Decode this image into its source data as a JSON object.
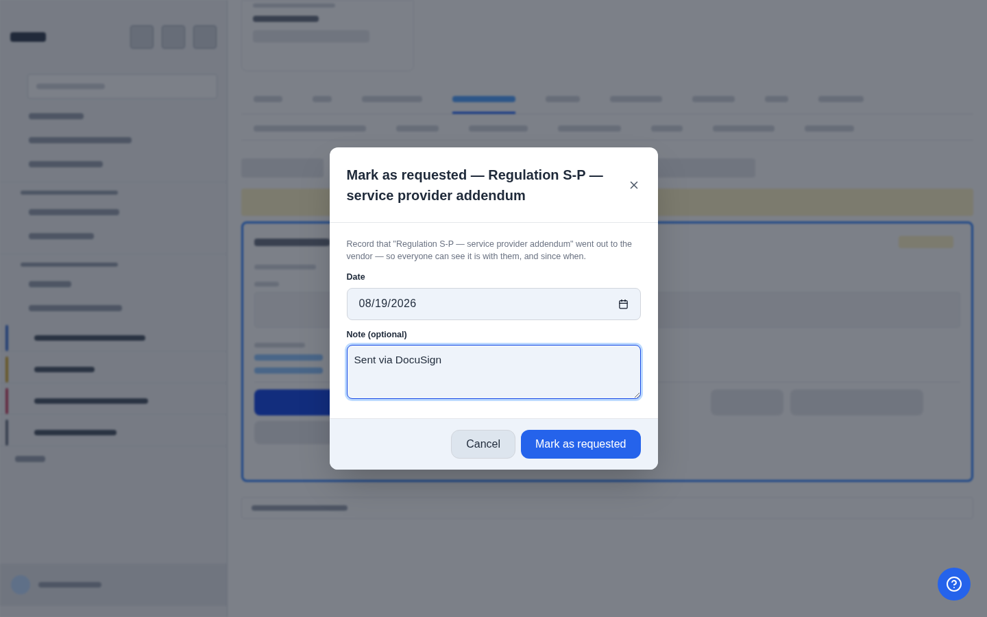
{
  "dialog": {
    "title": "Mark as requested — Regulation S-P — service provider addendum",
    "description": "Record that \"Regulation S-P — service provider addendum\" went out to the vendor — so everyone can see it is with them, and since when.",
    "date": {
      "label": "Date",
      "value": "08/19/2026"
    },
    "note": {
      "label": "Note (optional)",
      "value": "Sent via DocuSign",
      "focused": true
    },
    "buttons": [
      {
        "label": "Cancel",
        "kind": "secondary"
      },
      {
        "label": "Mark as requested",
        "kind": "primary"
      }
    ]
  }
}
